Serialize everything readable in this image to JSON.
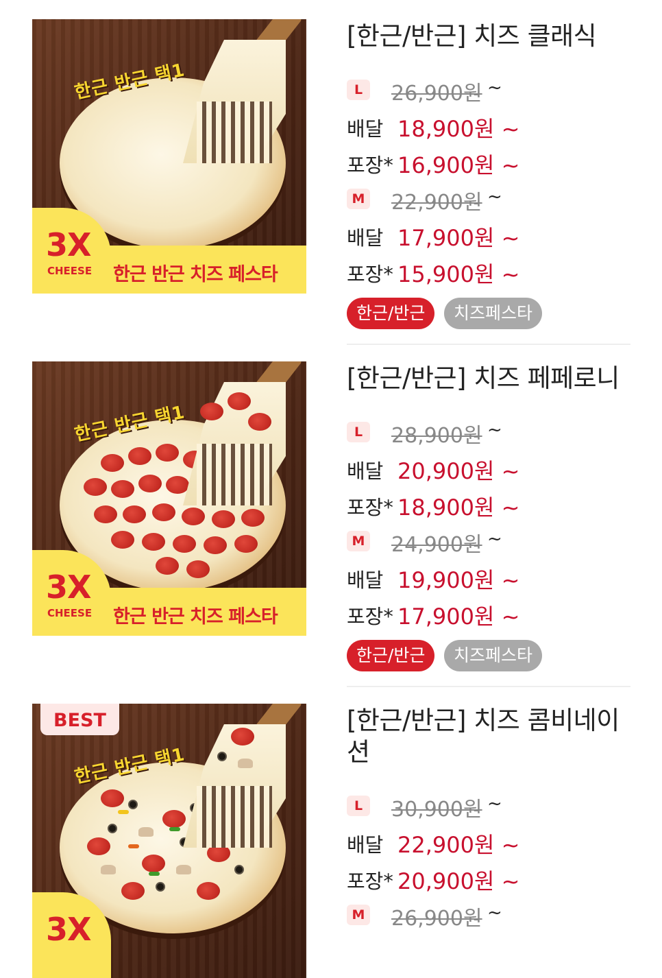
{
  "products": [
    {
      "image": {
        "promo_top": "한근 반근 택1",
        "x_label": "3X",
        "cheese_label": "CHEESE",
        "banner_text": "한근 반근 치즈 페스타"
      },
      "title": "[한근/반근] 치즈 클래식",
      "sizes": [
        {
          "size": "L",
          "original": "26,900원",
          "tilde": "~",
          "delivery_label": "배달",
          "delivery": "18,900원 ~",
          "pickup_label": "포장*",
          "pickup": "16,900원 ~"
        },
        {
          "size": "M",
          "original": "22,900원",
          "tilde": "~",
          "delivery_label": "배달",
          "delivery": "17,900원 ~",
          "pickup_label": "포장*",
          "pickup": "15,900원 ~"
        }
      ],
      "tags": [
        "한근/반근",
        "치즈페스타"
      ]
    },
    {
      "image": {
        "promo_top": "한근 반근 택1",
        "x_label": "3X",
        "cheese_label": "CHEESE",
        "banner_text": "한근 반근 치즈 페스타"
      },
      "title": "[한근/반근] 치즈 페페로니",
      "sizes": [
        {
          "size": "L",
          "original": "28,900원",
          "tilde": "~",
          "delivery_label": "배달",
          "delivery": "20,900원 ~",
          "pickup_label": "포장*",
          "pickup": "18,900원 ~"
        },
        {
          "size": "M",
          "original": "24,900원",
          "tilde": "~",
          "delivery_label": "배달",
          "delivery": "19,900원 ~",
          "pickup_label": "포장*",
          "pickup": "17,900원 ~"
        }
      ],
      "tags": [
        "한근/반근",
        "치즈페스타"
      ]
    },
    {
      "image": {
        "badge": "BEST",
        "promo_top": "한근 반근 택1",
        "x_label": "3X"
      },
      "title": "[한근/반근] 치즈 콤비네이션",
      "sizes": [
        {
          "size": "L",
          "original": "30,900원",
          "tilde": "~",
          "delivery_label": "배달",
          "delivery": "22,900원 ~",
          "pickup_label": "포장*",
          "pickup": "20,900원 ~"
        },
        {
          "size": "M",
          "original": "26,900원",
          "tilde": "~"
        }
      ]
    }
  ],
  "colors": {
    "price_red": "#c8102e",
    "tag_red": "#d7202a",
    "tag_gray": "#a9a9a9",
    "size_badge_bg": "#fde8e6",
    "banner_yellow": "#fbe45a"
  }
}
